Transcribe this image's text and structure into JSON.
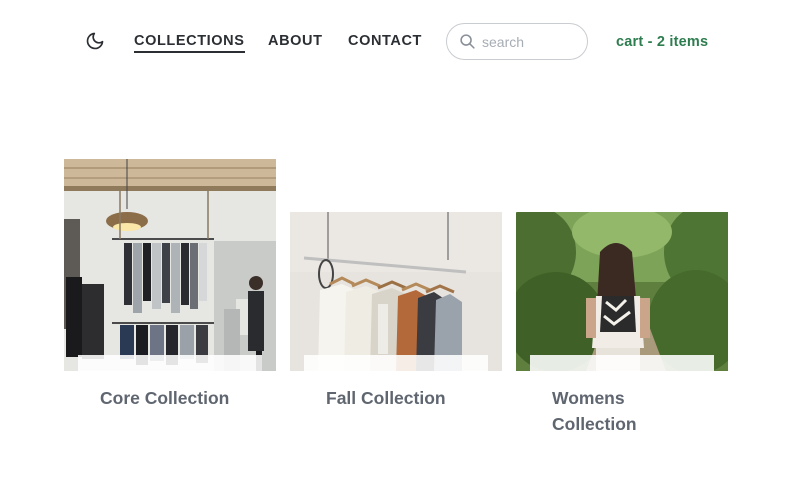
{
  "nav": {
    "theme_icon": "moon-icon",
    "links": [
      {
        "label": "COLLECTIONS",
        "active": true
      },
      {
        "label": "ABOUT",
        "active": false
      },
      {
        "label": "CONTACT",
        "active": false
      }
    ],
    "search": {
      "placeholder": "search",
      "value": "",
      "icon": "search-icon"
    },
    "cart_label": "cart - 2 items"
  },
  "collections": [
    {
      "title": "Core Collection",
      "image": "store-interior-photo"
    },
    {
      "title": "Fall Collection",
      "image": "hanging-clothes-photo"
    },
    {
      "title": "Womens Collection",
      "image": "woman-in-forest-photo"
    }
  ],
  "colors": {
    "text": "#2b2f33",
    "cart": "#2e7d4f",
    "card_title": "#5f6670",
    "search_border": "#c9ccd0"
  }
}
